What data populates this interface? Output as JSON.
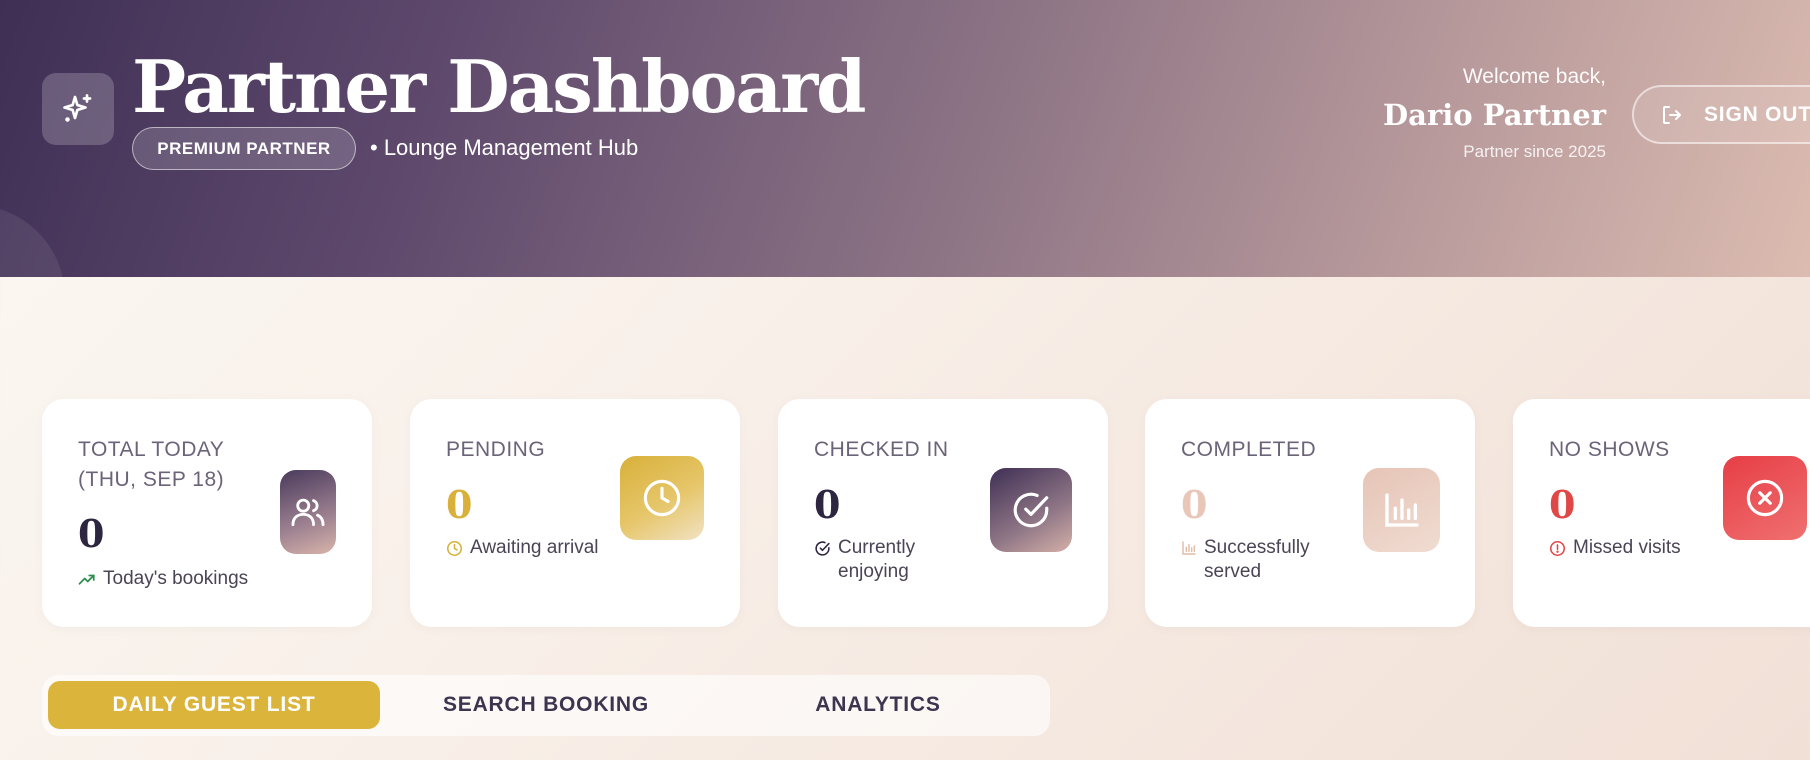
{
  "header": {
    "title": "Partner Dashboard",
    "badge": "PREMIUM PARTNER",
    "subtitle": "• Lounge Management Hub",
    "logo_icon": "sparkles-icon"
  },
  "user": {
    "welcome": "Welcome back,",
    "name": "Dario Partner",
    "since": "Partner since 2025",
    "signout_label": "SIGN OUT",
    "signout_icon": "log-out-icon"
  },
  "stats": [
    {
      "label_line1": "TOTAL TODAY",
      "label_line2": "(THU, SEP 18)",
      "value": "0",
      "sub": "Today's bookings",
      "icon": "users-icon",
      "sub_icon": "trending-up-icon",
      "value_color": "#2e2540"
    },
    {
      "label": "PENDING",
      "value": "0",
      "sub": "Awaiting arrival",
      "icon": "clock-icon",
      "sub_icon": "clock-icon",
      "value_color": "#d8b03a"
    },
    {
      "label": "CHECKED IN",
      "value": "0",
      "sub_line1": "Currently",
      "sub_line2": "enjoying",
      "icon": "check-circle-icon",
      "sub_icon": "check-circle-icon",
      "value_color": "#2e2540"
    },
    {
      "label": "COMPLETED",
      "value": "0",
      "sub_line1": "Successfully",
      "sub_line2": "served",
      "icon": "bar-chart-icon",
      "sub_icon": "bar-chart-icon",
      "value_color": "#e8c6b8"
    },
    {
      "label": "NO SHOWS",
      "value": "0",
      "sub": "Missed visits",
      "icon": "x-circle-icon",
      "sub_icon": "alert-circle-icon",
      "value_color": "#e04848"
    }
  ],
  "tabs": [
    {
      "label": "DAILY GUEST LIST",
      "active": true
    },
    {
      "label": "SEARCH BOOKING",
      "active": false
    },
    {
      "label": "ANALYTICS",
      "active": false
    }
  ],
  "colors": {
    "accent_gold": "#dbb43c",
    "header_dark": "#3f2f55",
    "danger": "#e04848",
    "success": "#2f8f4e"
  }
}
